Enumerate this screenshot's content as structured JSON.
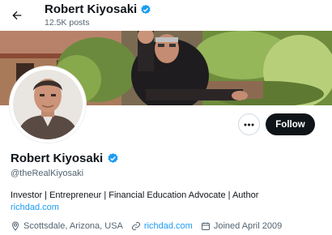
{
  "header": {
    "name": "Robert Kiyosaki",
    "posts": "12.5K posts",
    "back_icon": "arrow-left-icon"
  },
  "profile": {
    "name": "Robert Kiyosaki",
    "handle": "@theRealKiyosaki",
    "bio": "Investor | Entrepreneur | Financial Education Advocate | Author",
    "bio_link": "richdad.com",
    "location": "Scottsdale, Arizona, USA",
    "website": "richdad.com",
    "joined": "Joined April 2009",
    "verified_icon": "verified-badge-icon"
  },
  "actions": {
    "follow_label": "Follow",
    "more_label": "···"
  },
  "colors": {
    "accent": "#1d9bf0",
    "text": "#0f1419",
    "secondary": "#536471",
    "follow_bg": "#0f1419"
  }
}
